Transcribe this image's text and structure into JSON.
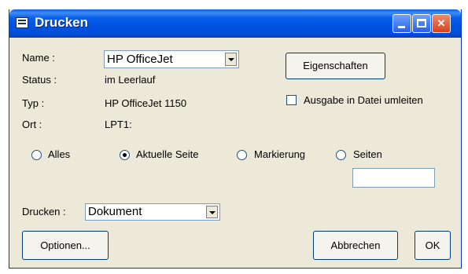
{
  "window": {
    "title": "Drucken"
  },
  "printer": {
    "name_label": "Name :",
    "name_value": "HP OfficeJet",
    "status_label": "Status :",
    "status_value": "im Leerlauf",
    "type_label": "Typ :",
    "type_value": "HP OfficeJet 1150",
    "location_label": "Ort :",
    "location_value": "LPT1:",
    "properties_button": "Eigenschaften",
    "print_to_file_label": "Ausgabe in Datei umleiten",
    "print_to_file_checked": false
  },
  "range": {
    "all_label": "Alles",
    "current_page_label": "Aktuelle Seite",
    "selection_label": "Markierung",
    "pages_label": "Seiten",
    "selected": "current_page",
    "pages_value": ""
  },
  "print_what": {
    "label": "Drucken :",
    "value": "Dokument"
  },
  "buttons": {
    "options": "Optionen...",
    "cancel": "Abbrechen",
    "ok": "OK"
  }
}
